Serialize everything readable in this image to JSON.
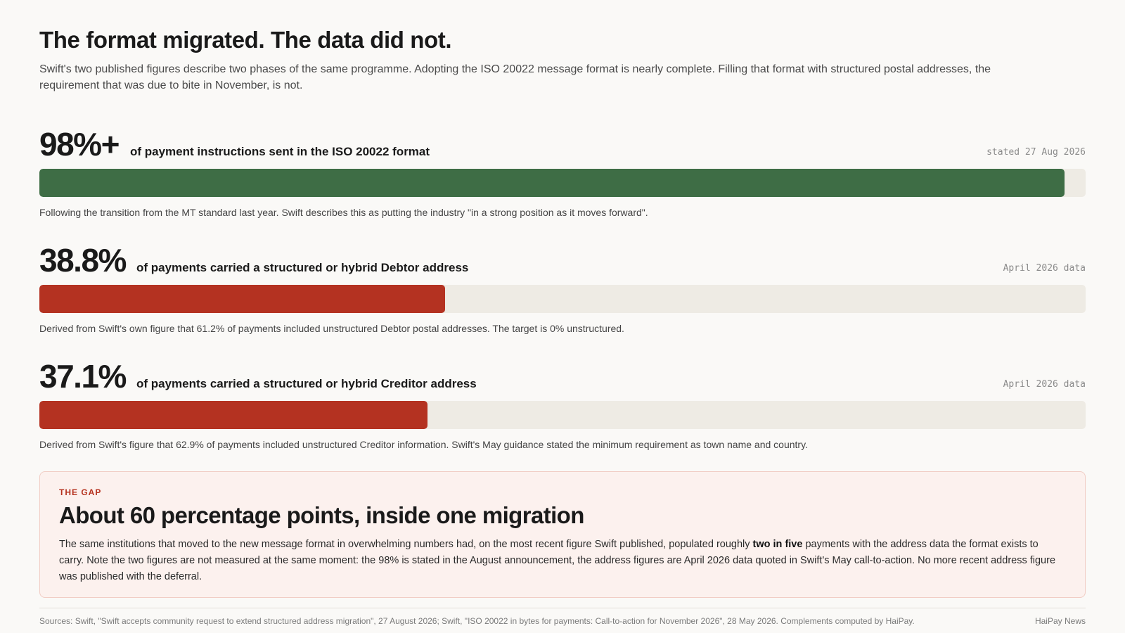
{
  "header": {
    "title": "The format migrated. The data did not.",
    "subtitle": "Swift's two published figures describe two phases of the same programme. Adopting the ISO 20022 message format is nearly complete. Filling that format with structured postal addresses, the requirement that was due to bite in November, is not."
  },
  "chart_data": {
    "type": "bar",
    "orientation": "horizontal",
    "xlim": [
      0,
      100
    ],
    "unit": "%",
    "bars": [
      {
        "display_value": "98%+",
        "value": 98,
        "label": "of payment instructions sent in the ISO 20022 format",
        "date": "stated 27 Aug 2026",
        "note": "Following the transition from the MT standard last year. Swift describes this as putting the industry \"in a strong position as it moves forward\".",
        "color": "#3e6d45"
      },
      {
        "display_value": "38.8%",
        "value": 38.8,
        "label": "of payments carried a structured or hybrid Debtor address",
        "date": "April 2026 data",
        "note": "Derived from Swift's own figure that 61.2% of payments included unstructured Debtor postal addresses. The target is 0% unstructured.",
        "color": "#b43221"
      },
      {
        "display_value": "37.1%",
        "value": 37.1,
        "label": "of payments carried a structured or hybrid Creditor address",
        "date": "April 2026 data",
        "note": "Derived from Swift's figure that 62.9% of payments included unstructured Creditor information. Swift's May guidance stated the minimum requirement as town name and country.",
        "color": "#b43221"
      }
    ],
    "track_color": "#eeebe4"
  },
  "gap": {
    "kicker": "THE GAP",
    "title": "About 60 percentage points, inside one migration",
    "body_before": "The same institutions that moved to the new message format in overwhelming numbers had, on the most recent figure Swift published, populated roughly ",
    "body_emphasis": "two in five",
    "body_after": " payments with the address data the format exists to carry. Note the two figures are not measured at the same moment: the 98% is stated in the August announcement, the address figures are April 2026 data quoted in Swift's May call-to-action. No more recent address figure was published with the deferral."
  },
  "footer": {
    "sources": "Sources: Swift, \"Swift accepts community request to extend structured address migration\", 27 August 2026; Swift, \"ISO 20022 in bytes for payments: Call-to-action for November 2026\", 28 May 2026. Complements computed by HaiPay.",
    "brand": "HaiPay News"
  }
}
